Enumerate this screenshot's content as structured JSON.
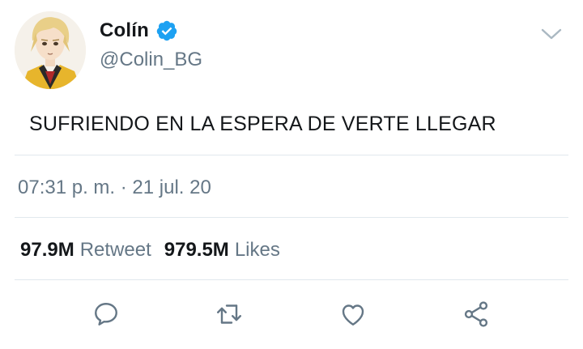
{
  "user": {
    "display_name": "Colín",
    "handle": "@Colin_BG",
    "verified_icon": "verified-badge-icon",
    "avatar": "illustrated-avatar"
  },
  "tweet": {
    "text": "SUFRIENDO EN LA ESPERA DE VERTE LLEGAR",
    "timestamp": "07:31 p. m. · 21 jul. 20"
  },
  "stats": {
    "retweets_count": "97.9M",
    "retweets_label": "Retweet",
    "likes_count": "979.5M",
    "likes_label": "Likes"
  },
  "actions": [
    "reply-icon",
    "retweet-icon",
    "like-icon",
    "share-icon"
  ],
  "colors": {
    "accent": "#1da1f2",
    "secondary_text": "#657786",
    "divider": "#e1e8ed",
    "primary_text": "#14171a"
  }
}
